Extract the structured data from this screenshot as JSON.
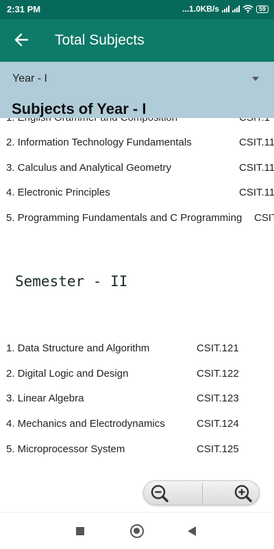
{
  "status_bar": {
    "time": "2:31 PM",
    "network_speed": "...1.0KB/s",
    "battery": "59",
    "icons": [
      "signal-icon",
      "signal-icon",
      "wifi-icon",
      "battery-icon"
    ]
  },
  "app_bar": {
    "title": "Total Subjects",
    "back_icon": "arrow-left-icon"
  },
  "year_select": {
    "value": "Year - I",
    "icon": "dropdown-arrow-icon"
  },
  "year_heading": "Subjects of Year - I",
  "semester1": {
    "rows": [
      {
        "name": "1. English Grammer and Composition",
        "code": "CSIT.1"
      },
      {
        "name": "2. Information Technology Fundamentals",
        "code": "CSIT.11"
      },
      {
        "name": "3. Calculus and Analytical Geometry",
        "code": "CSIT.11"
      },
      {
        "name": "4. Electronic Principles",
        "code": "CSIT.11"
      },
      {
        "name": "5. Programming Fundamentals and C Programming",
        "code": "CSIT"
      }
    ]
  },
  "semester2": {
    "heading": "Semester - II",
    "rows": [
      {
        "name": "1. Data Structure and Algorithm",
        "code": "CSIT.121"
      },
      {
        "name": "2. Digital Logic and Design",
        "code": "CSIT.122"
      },
      {
        "name": "3. Linear Algebra",
        "code": "CSIT.123"
      },
      {
        "name": "4. Mechanics and Electrodynamics",
        "code": "CSIT.124"
      },
      {
        "name": "5. Microprocessor System",
        "code": "CSIT.125"
      }
    ]
  },
  "zoom": {
    "out_icon": "zoom-out-icon",
    "in_icon": "zoom-in-icon"
  },
  "nav_bar": {
    "icons": [
      "recents-square-icon",
      "home-circle-icon",
      "back-triangle-icon"
    ]
  }
}
